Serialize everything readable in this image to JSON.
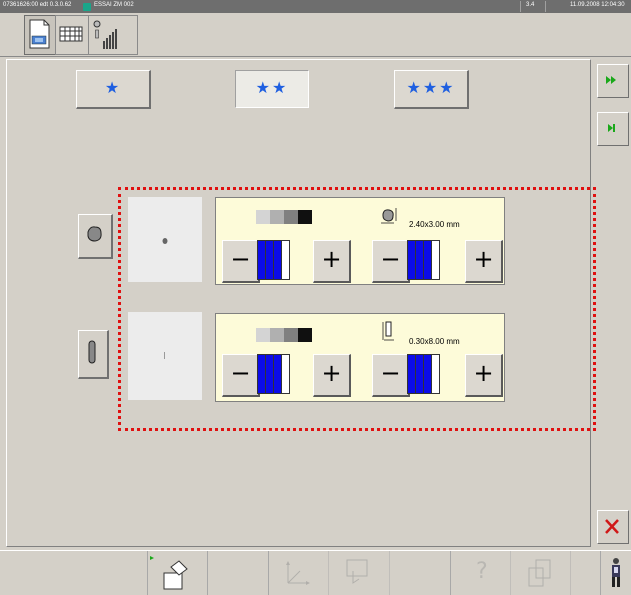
{
  "status_bar": {
    "file_info": "07361626:00 edt 0.3.0.62",
    "program": "ESSAI ZM 002",
    "page": "3.4",
    "datetime": "11.09.2008 12:04:30"
  },
  "toolbar": {
    "buttons": [
      "layout-icon",
      "grid-icon",
      "signal-levels-icon"
    ]
  },
  "quality": {
    "one_star": "★",
    "two_star": "★★",
    "three_star": "★★★",
    "selected": "two_star"
  },
  "rows": [
    {
      "shape": "round",
      "grey_levels": 4,
      "grey_value": 3,
      "size_value": 3,
      "size_text": "2.40x3.00 mm"
    },
    {
      "shape": "slot",
      "grey_levels": 4,
      "grey_value": 3,
      "size_value": 3,
      "size_text": "0.30x8.00 mm"
    }
  ],
  "controls": {
    "minus": "−",
    "plus": "+"
  },
  "colors": {
    "accent_blue": "#0b0be8",
    "frame_red": "#e01010",
    "panel_bg": "#fdfbd9",
    "star_blue": "#1f5fe0"
  },
  "bottom_bar": {
    "help_label": "?"
  }
}
